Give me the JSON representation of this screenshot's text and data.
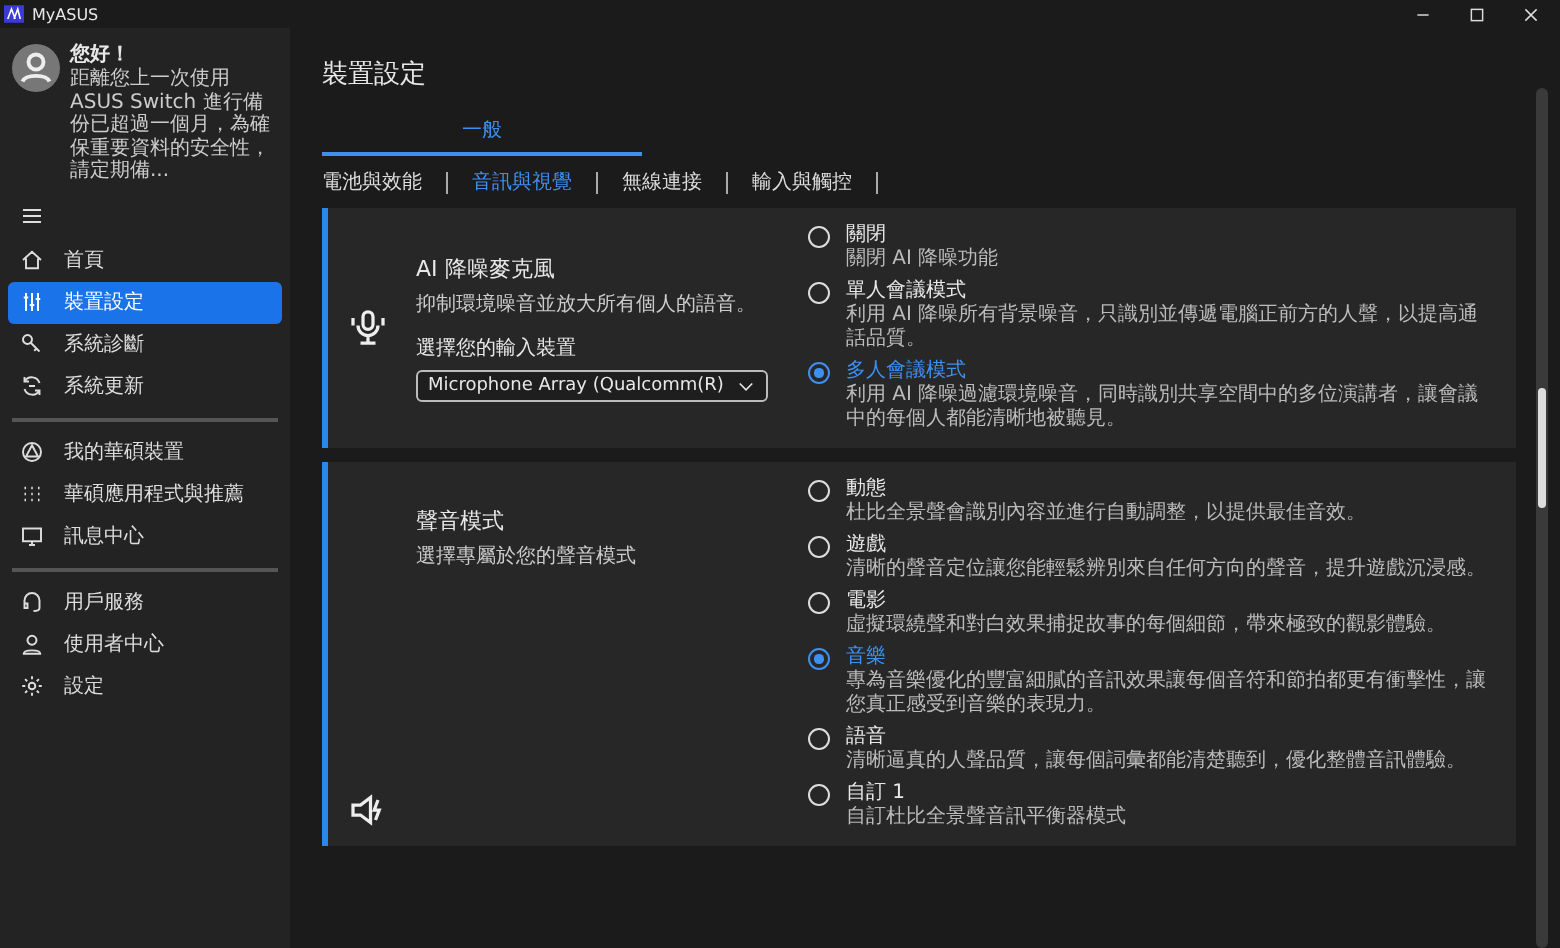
{
  "window": {
    "title": "MyASUS"
  },
  "account": {
    "greeting": "您好！",
    "message": "距離您上一次使用 ASUS Switch 進行備份已超過一個月，為確保重要資料的安全性，請定期備..."
  },
  "sidebar": {
    "groups": [
      [
        {
          "label": "首頁",
          "selected": false
        },
        {
          "label": "裝置設定",
          "selected": true
        },
        {
          "label": "系統診斷",
          "selected": false
        },
        {
          "label": "系統更新",
          "selected": false
        }
      ],
      [
        {
          "label": "我的華碩裝置",
          "selected": false
        },
        {
          "label": "華碩應用程式與推薦",
          "selected": false
        },
        {
          "label": "訊息中心",
          "selected": false
        }
      ],
      [
        {
          "label": "用戶服務",
          "selected": false
        },
        {
          "label": "使用者中心",
          "selected": false
        },
        {
          "label": "設定",
          "selected": false
        }
      ]
    ]
  },
  "page_title": "裝置設定",
  "tabs": [
    {
      "label": "一般",
      "selected": true
    }
  ],
  "subtabs": [
    {
      "label": "電池與效能",
      "selected": false
    },
    {
      "label": "音訊與視覺",
      "selected": true
    },
    {
      "label": "無線連接",
      "selected": false
    },
    {
      "label": "輸入與觸控",
      "selected": false
    }
  ],
  "cards": [
    {
      "title": "AI 降噪麥克風",
      "description": "抑制環境噪音並放大所有個人的語音。",
      "field_label": "選擇您的輸入裝置",
      "dropdown": {
        "value": "Microphone Array (Qualcomm(R)"
      },
      "options": [
        {
          "label": "關閉",
          "description": "關閉 AI 降噪功能",
          "selected": false
        },
        {
          "label": "單人會議模式",
          "description": "利用 AI 降噪所有背景噪音，只識別並傳遞電腦正前方的人聲，以提高通話品質。",
          "selected": false
        },
        {
          "label": "多人會議模式",
          "description": "利用 AI 降噪過濾環境噪音，同時識別共享空間中的多位演講者，讓會議中的每個人都能清晰地被聽見。",
          "selected": true
        }
      ]
    },
    {
      "title": "聲音模式",
      "description": "選擇專屬於您的聲音模式",
      "options": [
        {
          "label": "動態",
          "description": "杜比全景聲會識別內容並進行自動調整，以提供最佳音效。",
          "selected": false
        },
        {
          "label": "遊戲",
          "description": "清晰的聲音定位讓您能輕鬆辨別來自任何方向的聲音，提升遊戲沉浸感。",
          "selected": false
        },
        {
          "label": "電影",
          "description": "虛擬環繞聲和對白效果捕捉故事的每個細節，帶來極致的觀影體驗。",
          "selected": false
        },
        {
          "label": "音樂",
          "description": "專為音樂優化的豐富細膩的音訊效果讓每個音符和節拍都更有衝擊性，讓您真正感受到音樂的表現力。",
          "selected": true
        },
        {
          "label": "語音",
          "description": "清晰逼真的人聲品質，讓每個詞彙都能清楚聽到，優化整體音訊體驗。",
          "selected": false
        },
        {
          "label": "自訂 1",
          "description": "自訂杜比全景聲音訊平衡器模式",
          "selected": false
        }
      ]
    }
  ]
}
